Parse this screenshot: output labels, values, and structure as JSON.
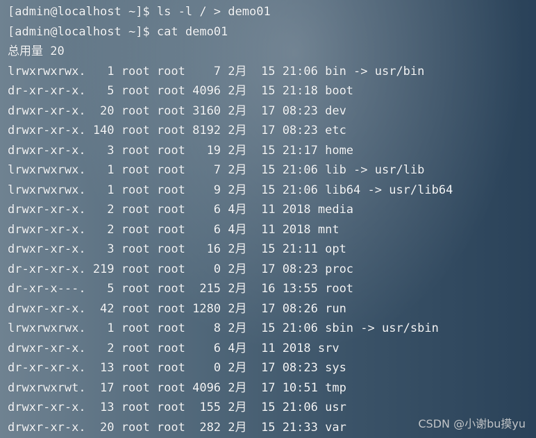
{
  "terminal": {
    "lines": [
      "[admin@localhost ~]$ ls -l / > demo01",
      "[admin@localhost ~]$ cat demo01",
      "总用量 20",
      "lrwxrwxrwx.   1 root root    7 2月  15 21:06 bin -> usr/bin",
      "dr-xr-xr-x.   5 root root 4096 2月  15 21:18 boot",
      "drwxr-xr-x.  20 root root 3160 2月  17 08:23 dev",
      "drwxr-xr-x. 140 root root 8192 2月  17 08:23 etc",
      "drwxr-xr-x.   3 root root   19 2月  15 21:17 home",
      "lrwxrwxrwx.   1 root root    7 2月  15 21:06 lib -> usr/lib",
      "lrwxrwxrwx.   1 root root    9 2月  15 21:06 lib64 -> usr/lib64",
      "drwxr-xr-x.   2 root root    6 4月  11 2018 media",
      "drwxr-xr-x.   2 root root    6 4月  11 2018 mnt",
      "drwxr-xr-x.   3 root root   16 2月  15 21:11 opt",
      "dr-xr-xr-x. 219 root root    0 2月  17 08:23 proc",
      "dr-xr-x---.   5 root root  215 2月  16 13:55 root",
      "drwxr-xr-x.  42 root root 1280 2月  17 08:26 run",
      "lrwxrwxrwx.   1 root root    8 2月  15 21:06 sbin -> usr/sbin",
      "drwxr-xr-x.   2 root root    6 4月  11 2018 srv",
      "dr-xr-xr-x.  13 root root    0 2月  17 08:23 sys",
      "drwxrwxrwt.  17 root root 4096 2月  17 10:51 tmp",
      "drwxr-xr-x.  13 root root  155 2月  15 21:06 usr",
      "drwxr-xr-x.  20 root root  282 2月  15 21:33 var"
    ]
  },
  "watermark": {
    "text": "CSDN @小谢bu摸yu"
  }
}
